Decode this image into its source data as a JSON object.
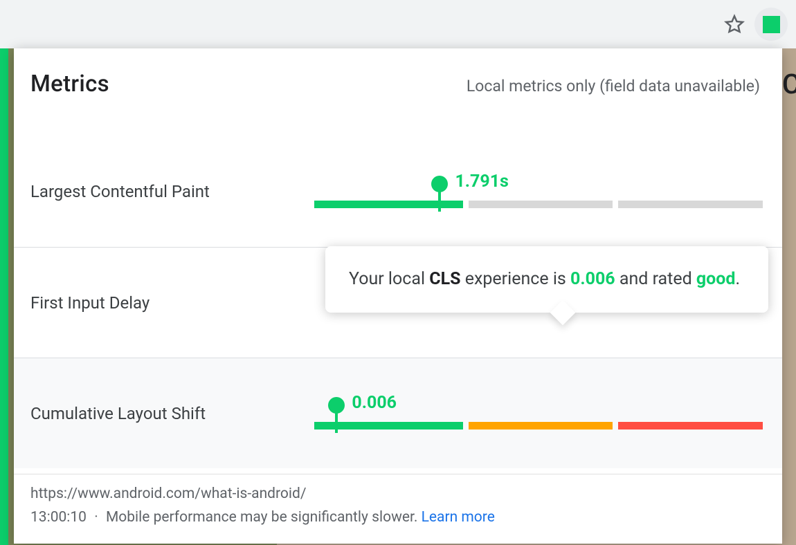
{
  "colors": {
    "good": "#0cce6b",
    "ni": "#ffa400",
    "poor": "#ff4e42",
    "neutral": "#d8d8d8",
    "link": "#1a73e8"
  },
  "panel": {
    "title": "Metrics",
    "subtitle": "Local metrics only (field data unavailable)"
  },
  "metrics": {
    "lcp": {
      "label": "Largest Contentful Paint",
      "value_display": "1.791s",
      "marker_left_pct": 28,
      "segments": [
        {
          "flex": 34,
          "style": "good"
        },
        {
          "flex": 33,
          "style": "neutral"
        },
        {
          "flex": 33,
          "style": "neutral"
        }
      ]
    },
    "fid": {
      "label": "First Input Delay"
    },
    "cls": {
      "label": "Cumulative Layout Shift",
      "value_display": "0.006",
      "marker_left_pct": 5,
      "segments": [
        {
          "flex": 34,
          "style": "good"
        },
        {
          "flex": 33,
          "style": "ni"
        },
        {
          "flex": 33,
          "style": "poor"
        }
      ]
    }
  },
  "tooltip": {
    "prefix": "Your local ",
    "metric_abbrev": "CLS",
    "mid": " experience is ",
    "value": "0.006",
    "mid2": " and rated ",
    "rating": "good",
    "suffix": "."
  },
  "footer": {
    "url": "https://www.android.com/what-is-android/",
    "time": "13:00:10",
    "note": "Mobile performance may be significantly slower.",
    "learn_more": "Learn more"
  }
}
